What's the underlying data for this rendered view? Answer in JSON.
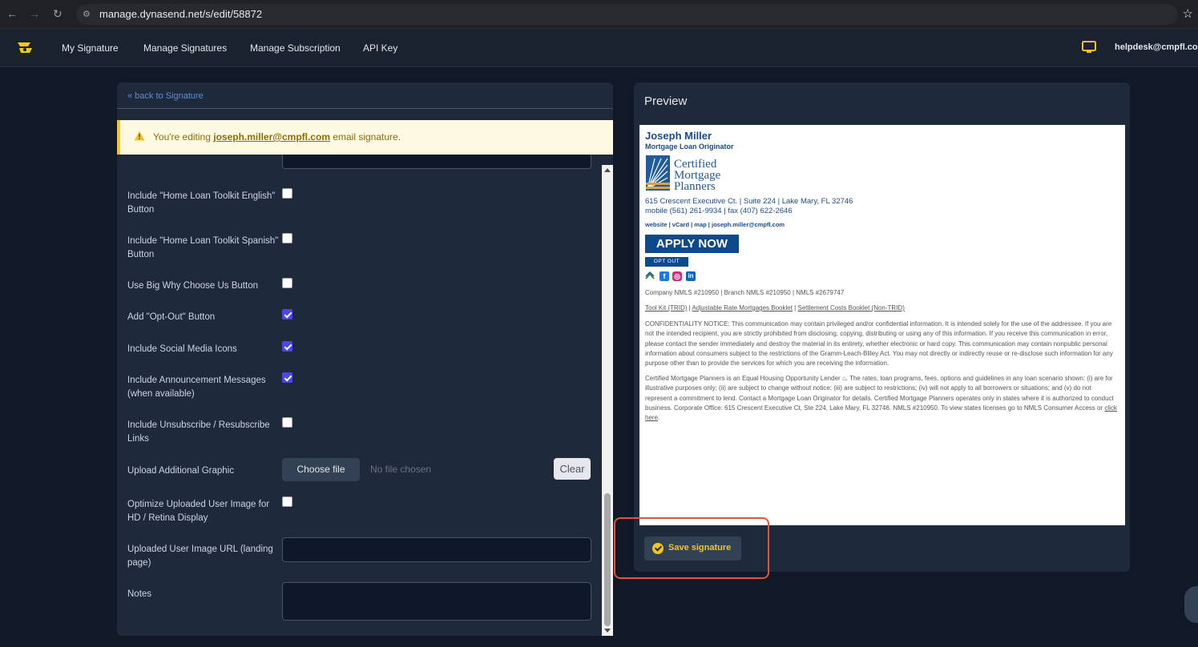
{
  "browser": {
    "url": "manage.dynasend.net/s/edit/58872"
  },
  "nav": {
    "links": [
      "My Signature",
      "Manage Signatures",
      "Manage Subscription",
      "API Key"
    ],
    "user_email": "helpdesk@cmpfl.co"
  },
  "editor": {
    "back_link": "« back to Signature",
    "alert_prefix": "You're editing",
    "alert_email": "joseph.miller@cmpfl.com",
    "alert_suffix": "email signature.",
    "fields": {
      "toolkit_english": "Include \"Home Loan Toolkit English\" Button",
      "toolkit_spanish": "Include \"Home Loan Toolkit Spanish\" Button",
      "why_choose": "Use Big Why Choose Us Button",
      "opt_out": "Add \"Opt-Out\" Button",
      "social": "Include Social Media Icons",
      "announce": "Include Announcement Messages (when available)",
      "unsubscribe": "Include Unsubscribe / Resubscribe Links",
      "upload_graphic": "Upload Additional Graphic",
      "optimize": "Optimize Uploaded User Image for HD / Retina Display",
      "image_url": "Uploaded User Image URL (landing page)",
      "notes": "Notes"
    },
    "checkbox_state": {
      "toolkit_english": false,
      "toolkit_spanish": false,
      "why_choose": false,
      "opt_out": true,
      "social": true,
      "announce": true,
      "unsubscribe": false,
      "optimize": false
    },
    "choose_file": "Choose file",
    "no_file": "No file chosen",
    "clear": "Clear"
  },
  "preview": {
    "title": "Preview",
    "save_button": "Save signature",
    "signature": {
      "name": "Joseph Miller",
      "title": "Mortgage Loan Originator",
      "logo_lines": [
        "Certified",
        "Mortgage",
        "Planners"
      ],
      "address": "615 Crescent Executive Ct. | Suite 224 | Lake Mary, FL 32746",
      "phones": "mobile (561) 261-9934 | fax (407) 622-2646",
      "links": "website | vCard | map | joseph.miller@cmpfl.com",
      "apply_now": "APPLY NOW",
      "opt_out": "OPT OUT",
      "social_icons": [
        "equal-housing-icon",
        "facebook-icon",
        "instagram-icon",
        "linkedin-icon"
      ],
      "nmls": "Company NMLS #210950 | Branch NMLS #210950 | NMLS #2679747",
      "toolkit_links": [
        "Tool Kit (TRID)",
        "Adjustable Rate Mortgages Booklet",
        "Settlement Costs Booklet (Non-TRID)"
      ],
      "confidentiality": "CONFIDENTIALITY NOTICE: This communication may contain privileged and/or confidential information. It is intended solely for the use of the addressee. If you are not the intended recipient, you are strictly prohibited from disclosing, copying, distributing or using any of this information. If you receive this communication in error, please contact the sender immediately and destroy the material in its entirety, whether electronic or hard copy. This communication may contain nonpublic personal information about consumers subject to the restrictions of the Gramm-Leach-Bliley Act. You may not directly or indirectly reuse or re-disclose such information for any purpose other than to provide the services for which you are receiving the information.",
      "eho_text_1": "Certified Mortgage Planners is an Equal Housing Opportunity Lender",
      "eho_text_2": ". The rates, loan programs, fees, options and guidelines in any loan scenario shown: (i) are for illustrative purposes only; (ii) are subject to change without notice; (iii) are subject to restrictions; (iv) will not apply to all borrowers or situations; and (v) do not represent a commitment to lend. Contact a Mortgage Loan Originator for details. Certified Mortgage Planners operates only in states where it is authorized to conduct business. Corporate Office: 615 Crescent Executive Ct, Ste 224, Lake Mary, FL 32746. NMLS #210950. To view states licenses go to NMLS Consumer Access or",
      "click_here": "click here",
      "eho_end": "."
    }
  }
}
